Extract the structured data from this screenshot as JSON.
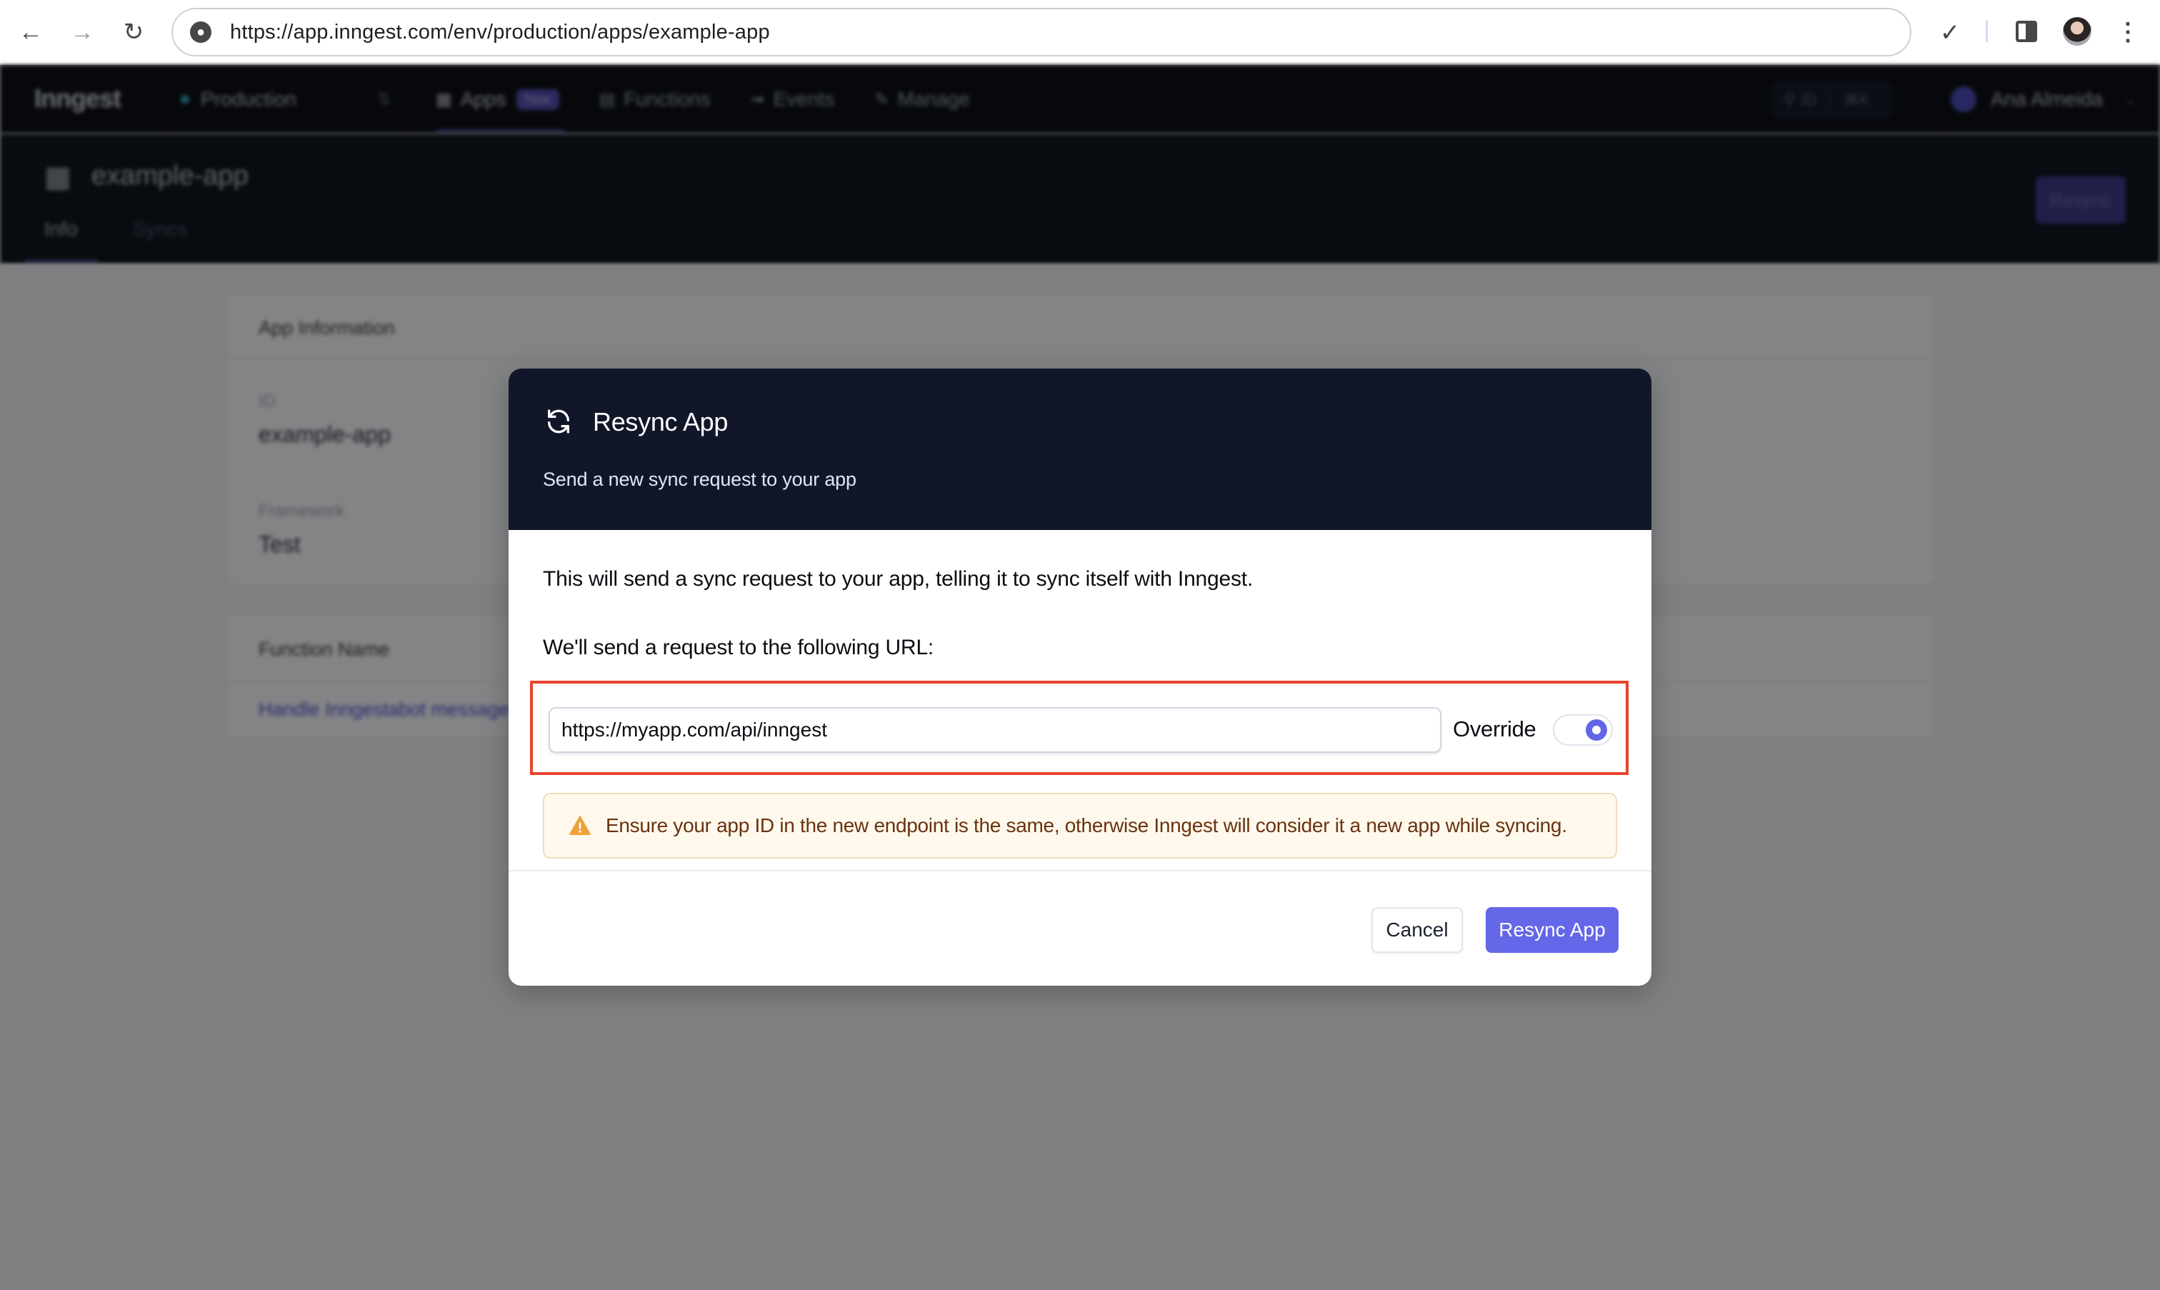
{
  "browser": {
    "url": "https://app.inngest.com/env/production/apps/example-app",
    "back_icon": "arrow-left-icon",
    "forward_icon": "arrow-right-icon",
    "reload_icon": "reload-icon",
    "site_info_icon": "globe-icon",
    "extensions_icon": "puzzle-icon",
    "side_panel_icon": "side-panel-icon",
    "profile_icon": "profile-avatar",
    "menu_icon": "kebab-menu-icon"
  },
  "app_nav": {
    "logo": "Inngest",
    "environment": "Production",
    "tabs": [
      {
        "label": "Apps",
        "badge": "New",
        "icon": "grid-icon",
        "active": true
      },
      {
        "label": "Functions",
        "icon": "function-icon",
        "active": false
      },
      {
        "label": "Events",
        "icon": "events-icon",
        "active": false
      },
      {
        "label": "Manage",
        "icon": "pencil-icon",
        "active": false
      }
    ],
    "search": {
      "label": "ID",
      "shortcut": "⌘K"
    },
    "user": {
      "name": "Ana Almeida"
    }
  },
  "subheader": {
    "app_name": "example-app",
    "tabs": [
      {
        "label": "Info",
        "active": true
      },
      {
        "label": "Syncs",
        "active": false
      }
    ],
    "resync_button": "Resync"
  },
  "page": {
    "app_info": {
      "title": "App Information",
      "fields": [
        {
          "label": "ID",
          "value": "example-app"
        },
        {
          "label": "Framework",
          "value": "Test"
        }
      ]
    },
    "functions": {
      "header": "Function Name",
      "rows": [
        "Handle Inngestabot message"
      ]
    }
  },
  "modal": {
    "title": "Resync App",
    "subtitle": "Send a new sync request to your app",
    "description": "This will send a sync request to your app, telling it to sync itself with Inngest.",
    "url_label": "We'll send a request to the following URL:",
    "url_value": "https://myapp.com/api/inngest",
    "override_label": "Override",
    "override_enabled": true,
    "warning": "Ensure your app ID in the new endpoint is the same, otherwise Inngest will consider it a new app while syncing.",
    "cancel_label": "Cancel",
    "confirm_label": "Resync App"
  },
  "colors": {
    "accent": "#6467e8",
    "modal_header": "#111729",
    "highlight": "#e8432b",
    "warning_bg": "#fef9ec",
    "warning_text": "#6a3210",
    "warning_icon": "#eea23a"
  }
}
